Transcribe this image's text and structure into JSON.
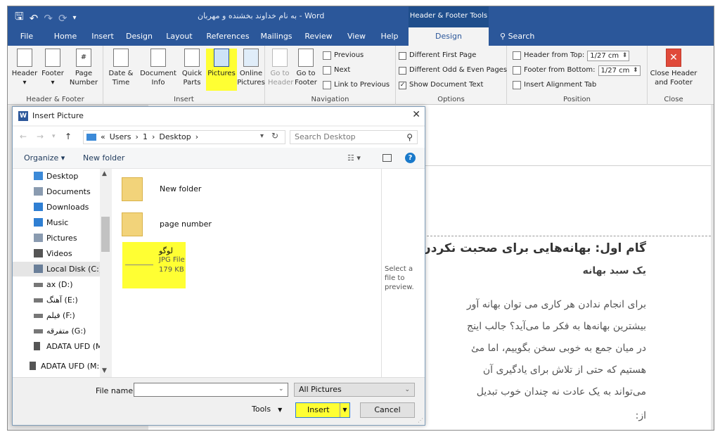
{
  "titlebar": {
    "doc_title": "به نام خداوند بخشنده و مهربان  -  Word",
    "context_title": "Header & Footer Tools"
  },
  "tabs": [
    {
      "label": "File"
    },
    {
      "label": "Home"
    },
    {
      "label": "Insert"
    },
    {
      "label": "Design"
    },
    {
      "label": "Layout"
    },
    {
      "label": "References"
    },
    {
      "label": "Mailings"
    },
    {
      "label": "Review"
    },
    {
      "label": "View"
    },
    {
      "label": "Help"
    },
    {
      "label": "Design",
      "active": true
    }
  ],
  "search_tab": "Search",
  "ribbon": {
    "groups": {
      "header_footer": "Header & Footer",
      "insert": "Insert",
      "navigation": "Navigation",
      "options": "Options",
      "position": "Position",
      "close": "Close"
    },
    "buttons": {
      "header": "Header",
      "footer": "Footer",
      "page_number_1": "Page",
      "page_number_2": "Number",
      "date_time_1": "Date &",
      "date_time_2": "Time",
      "doc_info_1": "Document",
      "doc_info_2": "Info",
      "quick_parts_1": "Quick",
      "quick_parts_2": "Parts",
      "pictures": "Pictures",
      "online_pictures_1": "Online",
      "online_pictures_2": "Pictures",
      "goto_header_1": "Go to",
      "goto_header_2": "Header",
      "goto_footer_1": "Go to",
      "goto_footer_2": "Footer",
      "previous": "Previous",
      "next": "Next",
      "link_to_previous": "Link to Previous",
      "close_hf_1": "Close Header",
      "close_hf_2": "and Footer"
    },
    "options": {
      "different_first_page": "Different First Page",
      "different_odd_even": "Different Odd & Even Pages",
      "show_document_text": "Show Document Text",
      "show_document_text_checked": true
    },
    "position": {
      "header_from_top_label": "Header from Top:",
      "header_from_top_value": "1/27 cm",
      "footer_from_bottom_label": "Footer from Bottom:",
      "footer_from_bottom_value": "1/27 cm",
      "insert_alignment_tab": "Insert Alignment Tab"
    }
  },
  "document": {
    "heading": "گام اول: بهانه‌هایی برای صحبت نکردن",
    "subheading": "یک سبد بهانه",
    "paragraph_lines": [
      "برای انجام ندادن هر کاری می توان بهانه آور",
      "بیشترین بهانه‌ها به فکر ما می‌آید؟ جالب اینج",
      "در میان جمع به خوبی سخن بگوییم، اما مئ",
      "هستیم که حتی از تلاش برای یادگیری آن",
      "می‌تواند به یک عادت نه چندان خوب تبدیل",
      "از:"
    ]
  },
  "dialog": {
    "title": "Insert Picture",
    "address": {
      "prefix": "«",
      "segments": [
        "Users",
        "1",
        "Desktop"
      ],
      "separator": "›"
    },
    "search_placeholder": "Search Desktop",
    "organize": "Organize ▾",
    "new_folder": "New folder",
    "nav_items": [
      {
        "label": "Desktop",
        "icon": "desktop-icon",
        "color": "#3c8ad8"
      },
      {
        "label": "Documents",
        "icon": "documents-icon",
        "color": "#8a9bb0"
      },
      {
        "label": "Downloads",
        "icon": "downloads-icon",
        "color": "#2f7fd3"
      },
      {
        "label": "Music",
        "icon": "music-icon",
        "color": "#2f7fd3"
      },
      {
        "label": "Pictures",
        "icon": "pictures-icon",
        "color": "#8a9bb0"
      },
      {
        "label": "Videos",
        "icon": "videos-icon",
        "color": "#555555"
      },
      {
        "label": "Local Disk (C:)",
        "icon": "local-disk-icon",
        "color": "#6a7f99",
        "selected": true
      },
      {
        "label": "ax (D:)",
        "icon": "drive-icon",
        "color": "#777777"
      },
      {
        "label": "آهنگ (E:)",
        "icon": "drive-icon",
        "color": "#777777"
      },
      {
        "label": "فیلم (F:)",
        "icon": "drive-icon",
        "color": "#777777"
      },
      {
        "label": "متفرقه (G:)",
        "icon": "drive-icon",
        "color": "#777777"
      },
      {
        "label": "ADATA UFD (M:",
        "icon": "usb-drive-icon",
        "color": "#555555"
      },
      {
        "label": "ADATA UFD (M:)",
        "icon": "usb-drive-icon",
        "color": "#555555"
      }
    ],
    "files": [
      {
        "name": "New folder"
      },
      {
        "name": "page number"
      }
    ],
    "selected_file": {
      "name": "لوگو",
      "type": "JPG File",
      "size": "179 KB"
    },
    "preview_text": "Select a file to preview.",
    "file_name_label": "File name:",
    "file_name_value": "",
    "file_type": "All Pictures",
    "tools": "Tools",
    "insert": "Insert",
    "cancel": "Cancel"
  },
  "colors": {
    "accent": "#2b579a",
    "highlight": "#ffff33"
  }
}
